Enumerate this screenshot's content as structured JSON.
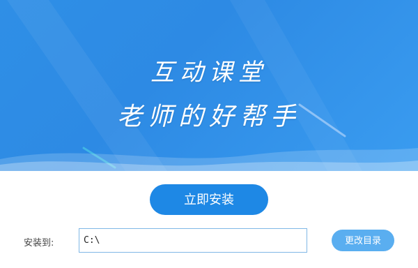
{
  "banner": {
    "slogan_line1": "互动课堂",
    "slogan_line2": "老师的好帮手",
    "gradient_start": "#2f8fe6",
    "gradient_end": "#3a9cf0"
  },
  "install": {
    "button_label": "立即安装",
    "button_color": "#1e88e5"
  },
  "path": {
    "label": "安装到:",
    "value": "C:\\",
    "change_label": "更改目录",
    "change_color": "#5aaef0"
  }
}
